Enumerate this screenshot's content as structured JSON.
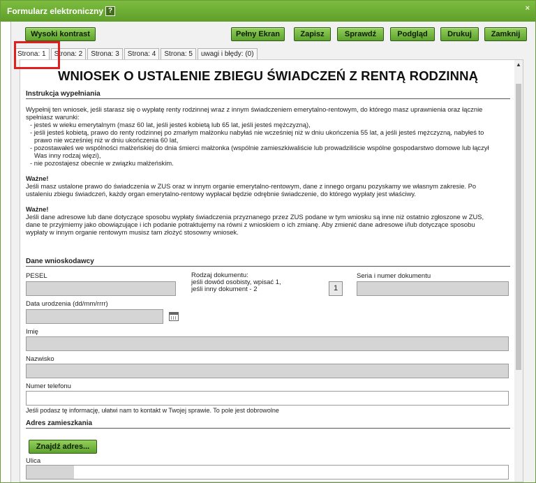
{
  "window": {
    "title": "Formularz elektroniczny",
    "help_icon": "?",
    "close_icon": "×"
  },
  "toolbar": {
    "high_contrast": "Wysoki kontrast",
    "fullscreen": "Pełny Ekran",
    "save": "Zapisz",
    "check": "Sprawdź",
    "preview": "Podgląd",
    "print": "Drukuj",
    "close": "Zamknij"
  },
  "tabs": [
    "Strona: 1",
    "Strona: 2",
    "Strona: 3",
    "Strona: 4",
    "Strona: 5",
    "uwagi i błędy: (0)"
  ],
  "form": {
    "title": "WNIOSEK O USTALENIE ZBIEGU ŚWIADCZEŃ Z RENTĄ RODZINNĄ",
    "instructions_head": "Instrukcja wypełniania",
    "intro1": "Wypełnij ten wniosek, jeśli starasz się o wypłatę renty rodzinnej wraz z innym świadczeniem emerytalno-rentowym, do którego masz uprawnienia oraz łącznie",
    "intro2": "spełniasz warunki:",
    "cond1": "- jesteś w wieku emerytalnym (masz 60 lat, jeśli jesteś kobietą lub 65 lat, jeśli jesteś mężczyzną),",
    "cond2a": "- jeśli jesteś kobietą, prawo do renty rodzinnej po zmarłym małżonku nabyłaś nie wcześniej niż w dniu ukończenia 55 lat, a jeśli jesteś mężczyzną, nabyłeś to",
    "cond2b": "prawo nie wcześniej niż w dniu ukończenia 60 lat,",
    "cond3a": "- pozostawałeś we wspólności małżeńskiej do dnia śmierci małżonka (wspólnie zamieszkiwaliście lub prowadziliście wspólne gospodarstwo domowe lub łączył",
    "cond3b": "Was inny rodzaj więzi),",
    "cond4": "- nie pozostajesz obecnie w związku małżeńskim.",
    "important1_head": "Ważne!",
    "important1_a": "Jeśli masz ustalone prawo do świadczenia w ZUS oraz w innym organie emerytalno-rentowym, dane z innego organu pozyskamy we własnym zakresie. Po",
    "important1_b": "ustaleniu zbiegu świadczeń, każdy organ emerytalno-rentowy wypłacał będzie odrębnie świadczenie, do którego wypłaty jest właściwy.",
    "important2_head": "Ważne!",
    "important2_a": "Jeśli dane adresowe lub dane dotyczące sposobu wypłaty świadczenia przyznanego przez ZUS podane w tym wniosku są inne niż ostatnio zgłoszone w ZUS,",
    "important2_b": "dane te przyjmiemy jako obowiązujące i ich podanie potraktujemy na równi z wnioskiem o ich zmianę. Aby zmienić dane adresowe i/lub dotyczące sposobu",
    "important2_c": "wypłaty w innym organie rentowym musisz tam złożyć stosowny wniosek.",
    "applicant_head": "Dane wnioskodawcy",
    "pesel_label": "PESEL",
    "doc_type_label1": "Rodzaj dokumentu:",
    "doc_type_label2": "jeśli dowód osobisty, wpisać 1,",
    "doc_type_label3": "jeśli inny dokument - 2",
    "doc_type_value": "1",
    "doc_number_label": "Seria i numer dokumentu",
    "birthdate_label": "Data urodzenia (dd/mm/rrrr)",
    "first_name_label": "Imię",
    "last_name_label": "Nazwisko",
    "phone_label": "Numer telefonu",
    "phone_hint": "Jeśli podasz tę informację, ułatwi nam to kontakt w Twojej sprawie. To pole jest dobrowolne",
    "address_head": "Adres zamieszkania",
    "find_address": "Znajdź adres...",
    "street_label": "Ulica"
  },
  "colors": {
    "accent": "#6fb136",
    "highlight": "#e02020"
  }
}
